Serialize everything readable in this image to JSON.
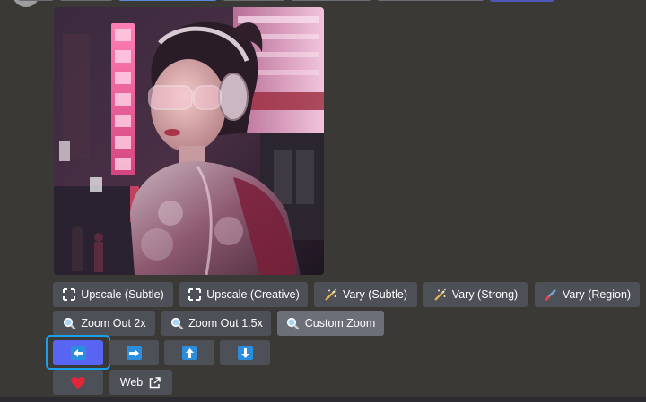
{
  "colors": {
    "background": "#3b3935",
    "button": "#4e5058",
    "button_active": "#6d6f78",
    "button_primary": "#5865f2",
    "focus_ring": "#1aa0e8",
    "arrow_icon_bg": "#2b8dde",
    "heart": "#e0283a"
  },
  "image": {
    "alt": ""
  },
  "rows": {
    "upscale_vary": [
      {
        "label": "Upscale (Subtle)",
        "icon": "expand-icon"
      },
      {
        "label": "Upscale (Creative)",
        "icon": "expand-icon"
      },
      {
        "label": "Vary (Subtle)",
        "icon": "magic-wand-icon"
      },
      {
        "label": "Vary (Strong)",
        "icon": "magic-wand-icon"
      },
      {
        "label": "Vary (Region)",
        "icon": "paintbrush-icon"
      }
    ],
    "zoom": [
      {
        "label": "Zoom Out 2x",
        "icon": "magnifier-icon"
      },
      {
        "label": "Zoom Out 1.5x",
        "icon": "magnifier-icon"
      },
      {
        "label": "Custom Zoom",
        "icon": "magnifier-icon"
      }
    ],
    "pan": [
      {
        "icon": "arrow-left-icon",
        "direction": "left",
        "selected": true
      },
      {
        "icon": "arrow-right-icon",
        "direction": "right"
      },
      {
        "icon": "arrow-up-icon",
        "direction": "up"
      },
      {
        "icon": "arrow-down-icon",
        "direction": "down"
      }
    ],
    "extra": {
      "favorite_icon": "heart-icon",
      "web_label": "Web",
      "web_icon": "external-link-icon"
    }
  }
}
